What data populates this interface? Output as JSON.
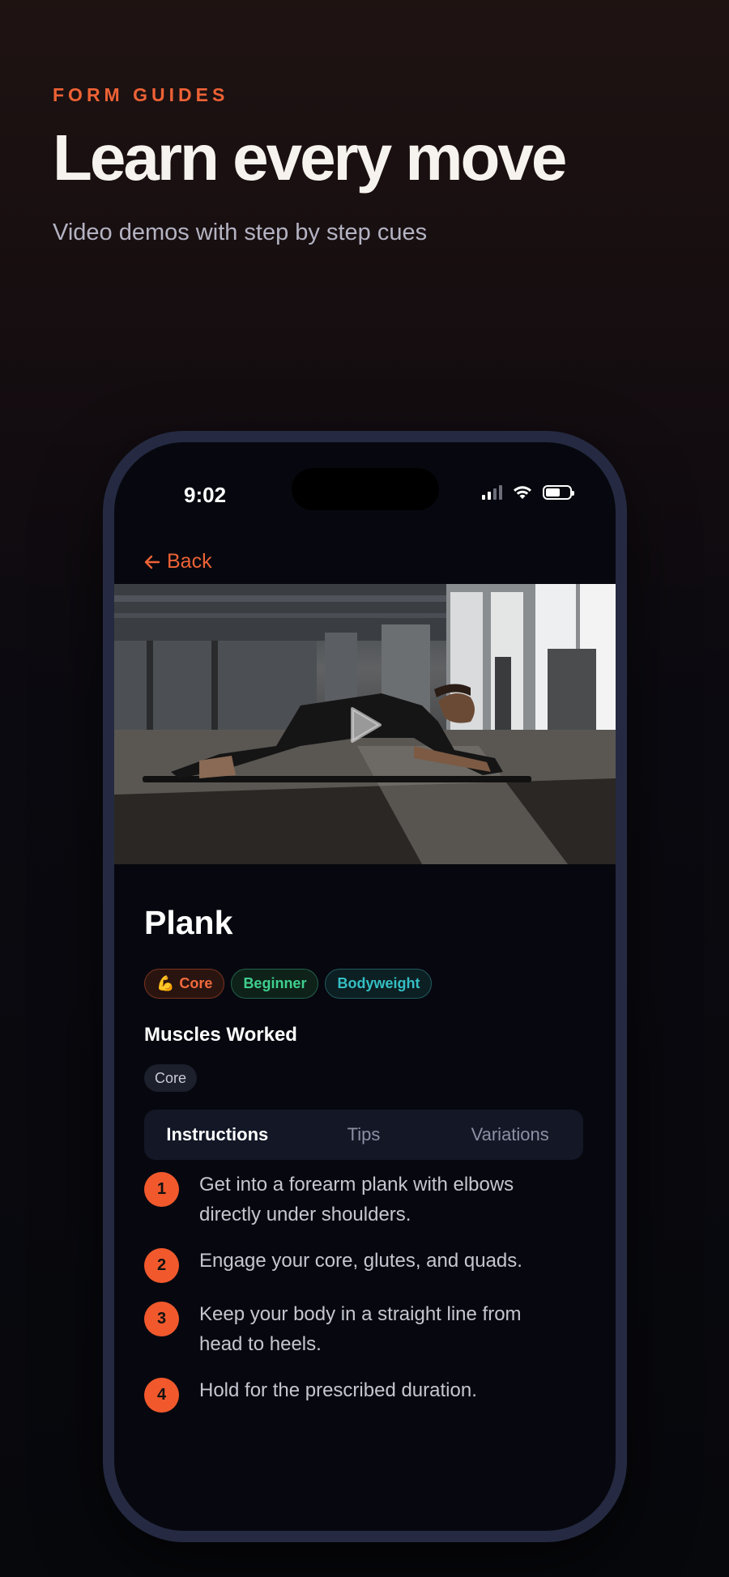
{
  "promo": {
    "eyebrow": "FORM GUIDES",
    "headline": "Learn every move",
    "subhead": "Video demos with step by step cues"
  },
  "status_bar": {
    "time": "9:02",
    "icons": [
      "cellular-signal-icon",
      "wifi-icon",
      "battery-icon"
    ]
  },
  "nav": {
    "back_label": "Back",
    "back_icon": "arrow-left-icon"
  },
  "video": {
    "description_icon": "play-icon"
  },
  "exercise": {
    "name": "Plank",
    "tags": [
      {
        "emoji": "💪",
        "label": "Core",
        "color": "#f06a3c"
      },
      {
        "label": "Beginner",
        "color": "#3fcf8e"
      },
      {
        "label": "Bodyweight",
        "color": "#35bfc4"
      }
    ],
    "muscles_heading": "Muscles Worked",
    "muscles": [
      "Core"
    ]
  },
  "tabs": [
    {
      "label": "Instructions",
      "active": true
    },
    {
      "label": "Tips",
      "active": false
    },
    {
      "label": "Variations",
      "active": false
    }
  ],
  "steps": [
    {
      "number": "1",
      "text": "Get into a forearm plank with elbows directly under shoulders."
    },
    {
      "number": "2",
      "text": "Engage your core, glutes, and quads."
    },
    {
      "number": "3",
      "text": "Keep your body in a straight line from head to heels."
    },
    {
      "number": "4",
      "text": "Hold for the prescribed duration."
    }
  ],
  "colors": {
    "accent": "#ee6235",
    "background": "#07080f",
    "phone_frame": "#252a42"
  }
}
